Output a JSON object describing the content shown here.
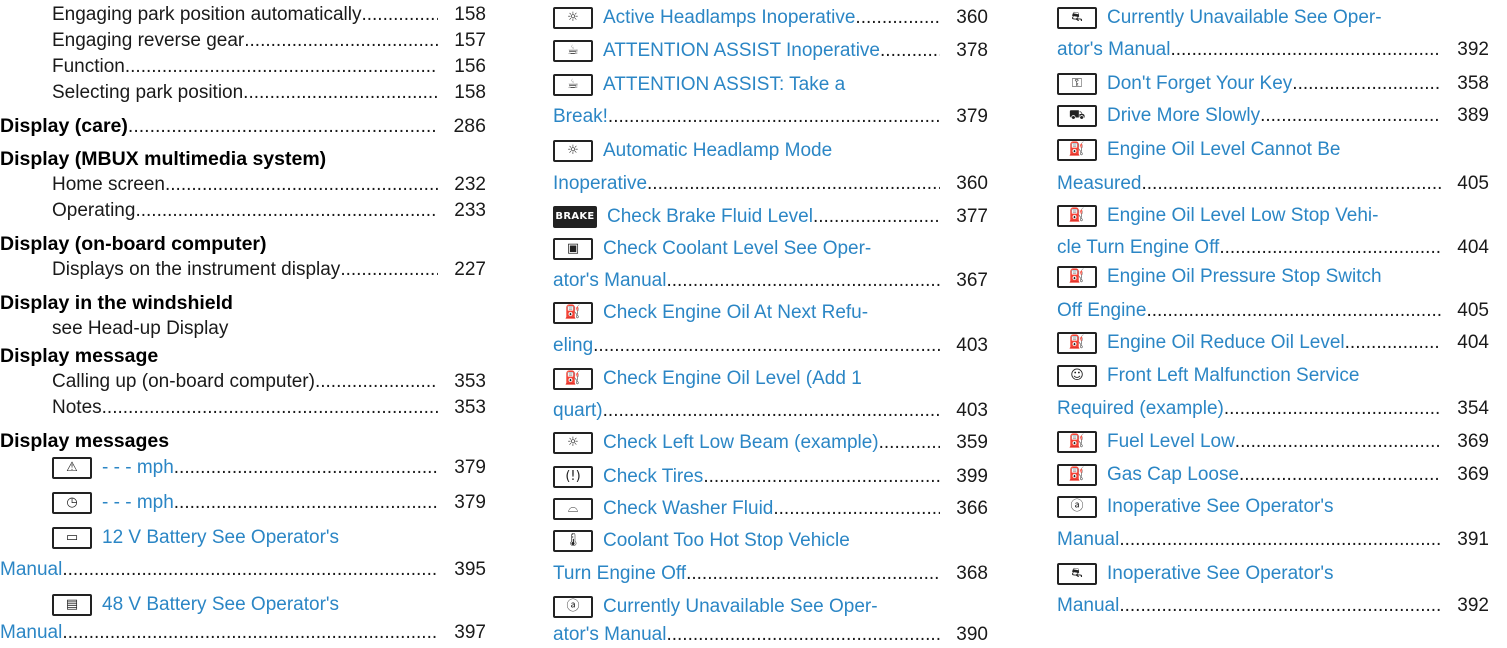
{
  "col1": {
    "r1": {
      "label": "Engaging park position automatically",
      "page": "158"
    },
    "r2": {
      "label": "Engaging reverse gear",
      "page": "157"
    },
    "r3": {
      "label": "Function",
      "page": "156"
    },
    "r4": {
      "label": "Selecting park position",
      "page": "158"
    },
    "display_care": {
      "label": "Display (care)",
      "page": "286"
    },
    "h_mbux": "Display (MBUX multimedia system)",
    "home_screen": {
      "label": "Home screen",
      "page": "232"
    },
    "operating": {
      "label": "Operating",
      "page": "233"
    },
    "h_onboard": "Display (on-board computer)",
    "displays_instrument": {
      "label": "Displays on the instrument display",
      "page": "227"
    },
    "h_windshield": "Display in the windshield",
    "see_hud": "see Head-up Display",
    "h_message": "Display message",
    "calling_up": {
      "label": "Calling up (on-board computer)",
      "page": "353"
    },
    "notes": {
      "label": "Notes",
      "page": "353"
    },
    "h_messages": "Display messages",
    "mph1": {
      "label": "- - - mph",
      "page": "379"
    },
    "mph2": {
      "label": "- - - mph",
      "page": "379"
    },
    "bat12": {
      "line1": "12 V Battery See Operator's",
      "line2": "Manual",
      "page": "395"
    },
    "bat48": {
      "line1": "48 V Battery See Operator's",
      "line2": "Manual",
      "page": "397"
    }
  },
  "col2": {
    "active_headlamps": {
      "label": "Active Headlamps Inoperative",
      "page": "360"
    },
    "attention_inop": {
      "label": "ATTENTION ASSIST Inoperative",
      "page": "378"
    },
    "attention_break": {
      "line1": "ATTENTION ASSIST: Take a",
      "line2": "Break!",
      "page": "379"
    },
    "auto_headlamp": {
      "line1": "Automatic Headlamp Mode",
      "line2": "Inoperative",
      "page": "360"
    },
    "brake_fluid": {
      "icon_text": "BRAKE",
      "label": "Check Brake Fluid Level",
      "page": "377"
    },
    "coolant_level": {
      "line1": "Check Coolant Level See Oper-",
      "line2": "ator's Manual",
      "page": "367"
    },
    "oil_next": {
      "line1": "Check Engine Oil At Next Refu-",
      "line2": "eling",
      "page": "403"
    },
    "oil_level_add": {
      "line1": "Check Engine Oil Level (Add 1",
      "line2": "quart)",
      "page": "403"
    },
    "low_beam": {
      "label": "Check Left Low Beam (example)",
      "page": "359"
    },
    "tires": {
      "label": "Check Tires",
      "page": "399"
    },
    "washer": {
      "label": "Check Washer Fluid",
      "page": "366"
    },
    "coolant_hot": {
      "line1": "Coolant Too Hot Stop Vehicle",
      "line2": "Turn Engine Off",
      "page": "368"
    },
    "abs_unavail": {
      "line1": "Currently Unavailable See Oper-",
      "line2": "ator's Manual",
      "page": "390"
    }
  },
  "col3": {
    "esp_unavail": {
      "line1": "Currently Unavailable See Oper-",
      "line2": "ator's Manual",
      "page": "392"
    },
    "key": {
      "label": "Don't Forget Your Key",
      "page": "358"
    },
    "slowly": {
      "label": "Drive More Slowly",
      "page": "389"
    },
    "oil_cannot": {
      "line1": "Engine Oil Level Cannot Be",
      "line2": "Measured",
      "page": "405"
    },
    "oil_low_stop": {
      "line1": "Engine Oil Level Low Stop Vehi-",
      "line2": "cle Turn Engine Off",
      "page": "404"
    },
    "oil_pressure": {
      "line1": "Engine Oil Pressure Stop Switch",
      "line2": "Off Engine",
      "page": "405"
    },
    "oil_reduce": {
      "label": "Engine Oil Reduce Oil Level",
      "page": "404"
    },
    "front_left": {
      "line1": "Front Left Malfunction Service",
      "line2": "Required (example)",
      "page": "354"
    },
    "fuel_low": {
      "label": "Fuel Level Low",
      "page": "369"
    },
    "gas_cap": {
      "label": "Gas Cap Loose",
      "page": "369"
    },
    "abs_inop": {
      "line1": "Inoperative See Operator's",
      "line2": "Manual",
      "page": "391"
    },
    "esp_inop": {
      "line1": "Inoperative See Operator's",
      "line2": "Manual",
      "page": "392"
    }
  },
  "colors": {
    "link": "#2b86c5",
    "text": "#1a1a1a"
  },
  "icons": [
    "speedometer-warning-icon",
    "speedometer-icon",
    "battery-12v-icon",
    "battery-48v-icon",
    "headlamp-icon",
    "coffee-cup-icon",
    "brake-icon",
    "coolant-icon",
    "oil-can-icon",
    "tire-pressure-icon",
    "washer-fluid-icon",
    "thermometer-icon",
    "abs-icon",
    "esp-icon",
    "key-icon",
    "slow-car-icon",
    "airbag-icon",
    "fuel-pump-icon"
  ]
}
